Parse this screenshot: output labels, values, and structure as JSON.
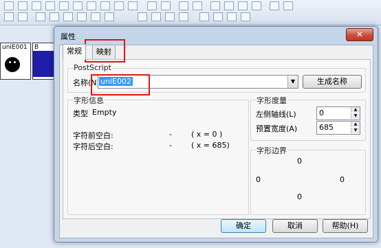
{
  "background_app": {
    "glyph_tiles": [
      {
        "label": "uniE001",
        "icon": "smiley-icon"
      },
      {
        "label": "B"
      }
    ]
  },
  "dialog": {
    "title": "属性",
    "close_glyph": "✕",
    "tabs": [
      {
        "label": "常规"
      },
      {
        "label": "映射"
      }
    ],
    "postscript": {
      "group_label": "PostScript",
      "name_label": "名称(N)",
      "name_value": "uniE002",
      "generate_button": "生成名称"
    },
    "glyph_info": {
      "group_label": "字形信息",
      "type_label": "类型",
      "type_value": "Empty",
      "lsb_label": "字符前空白:",
      "lsb_dash": "-",
      "lsb_value": "( x = 0 )",
      "rsb_label": "字符后空白:",
      "rsb_dash": "-",
      "rsb_value": "( x = 685)"
    },
    "metrics": {
      "group_label": "字形度量",
      "left_axis_label": "左侧轴线(L)",
      "left_axis_value": "0",
      "preset_width_label": "预置宽度(A)",
      "preset_width_value": "685"
    },
    "bounds": {
      "group_label": "字形边界",
      "top": "0",
      "left": "0",
      "right": "0",
      "bottom": "0"
    },
    "buttons": {
      "ok": "确定",
      "cancel": "取消",
      "help": "帮助(H)"
    },
    "colors": {
      "highlight": "#3399ff",
      "annotation": "#e01313",
      "close": "#c9503d"
    }
  }
}
